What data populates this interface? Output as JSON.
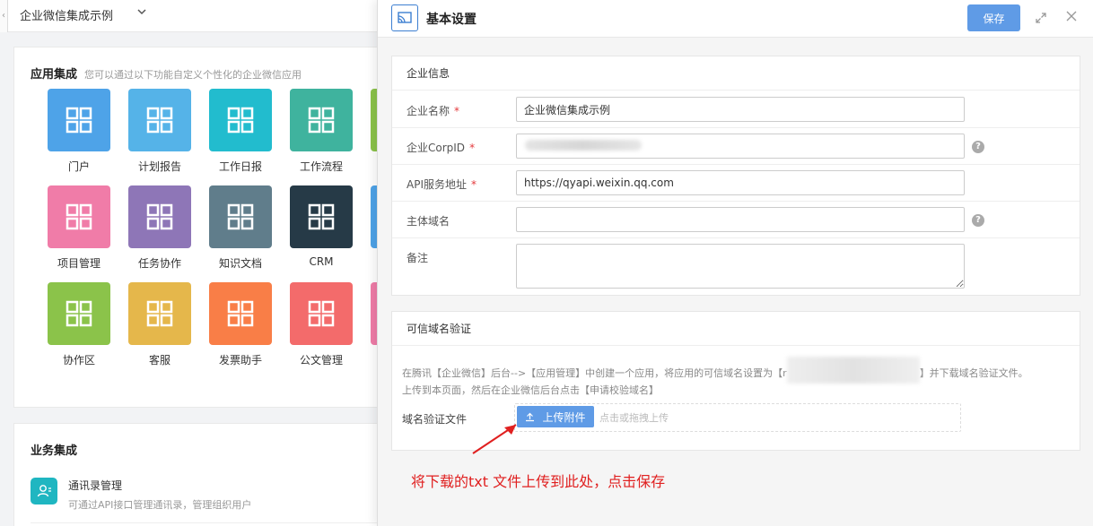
{
  "left": {
    "topbar": {
      "title": "企业微信集成示例",
      "back": "‹"
    },
    "app_section": {
      "title": "应用集成",
      "subtitle": "您可以通过以下功能自定义个性化的企业微信应用",
      "apps": [
        {
          "label": "门户",
          "color": "#4ea3e8"
        },
        {
          "label": "计划报告",
          "color": "#55b3e8"
        },
        {
          "label": "工作日报",
          "color": "#22bcce"
        },
        {
          "label": "工作流程",
          "color": "#3fb39e"
        },
        {
          "label": "",
          "color": "#8bc34a"
        },
        {
          "label": "项目管理",
          "color": "#f07ca8"
        },
        {
          "label": "任务协作",
          "color": "#8e76b7"
        },
        {
          "label": "知识文档",
          "color": "#607d8b"
        },
        {
          "label": "CRM",
          "color": "#263a47"
        },
        {
          "label": "",
          "color": "#4ea3e8"
        },
        {
          "label": "协作区",
          "color": "#8bc34a"
        },
        {
          "label": "客服",
          "color": "#e5b74b"
        },
        {
          "label": "发票助手",
          "color": "#f97e47"
        },
        {
          "label": "公文管理",
          "color": "#f36b6b"
        },
        {
          "label": "",
          "color": "#f07ca8"
        }
      ]
    },
    "biz_section": {
      "title": "业务集成",
      "item": {
        "title": "通讯录管理",
        "desc": "可通过API接口管理通讯录，管理组织用户"
      }
    }
  },
  "drawer": {
    "title": "基本设置",
    "save_label": "保存",
    "company_panel": {
      "title": "企业信息",
      "fields": [
        {
          "label": "企业名称",
          "required": "*",
          "value": "企业微信集成示例",
          "placeholder": ""
        },
        {
          "label": "企业CorpID",
          "required": "*",
          "value": "",
          "placeholder": ""
        },
        {
          "label": "API服务地址",
          "required": "*",
          "value": "https://qyapi.weixin.qq.com",
          "placeholder": ""
        },
        {
          "label": "主体域名",
          "required": "",
          "value": "",
          "placeholder": ""
        },
        {
          "label": "备注",
          "required": "",
          "value": "",
          "placeholder": ""
        }
      ],
      "help": "?"
    },
    "domain_panel": {
      "title": "可信域名验证",
      "note_part1": "在腾讯【企业微信】后台-->【应用管理】中创建一个应用，将应用的可信域名设置为【",
      "note_part2": "】并下载域名验证文件。",
      "note_part3": "上传到本页面，然后在企业微信后台点击【申请校验域名】",
      "note_blurred_char": "r",
      "file_label": "域名验证文件",
      "upload_label": "上传附件",
      "upload_hint": "点击或拖拽上传"
    }
  },
  "annotation": "将下载的txt 文件上传到此处，点击保存",
  "colors": {
    "accent": "#5f9be6",
    "annotation": "#e02020",
    "required": "#e4393c"
  }
}
